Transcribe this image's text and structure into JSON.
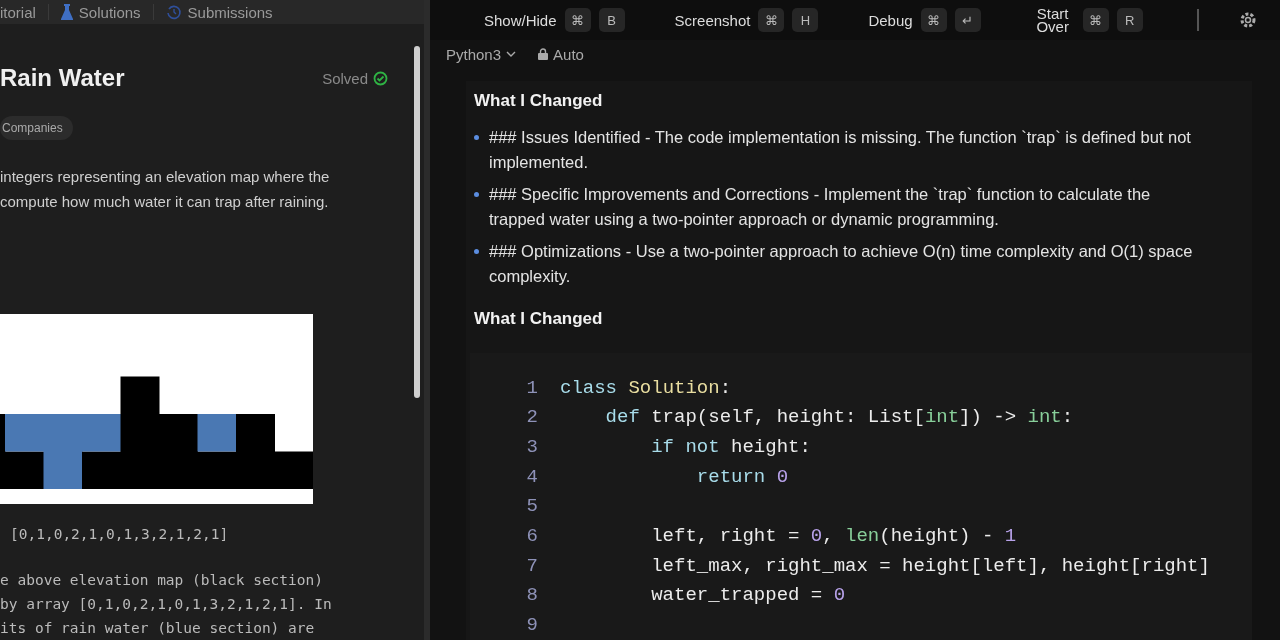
{
  "problem_tabs": [
    {
      "label": "itorial"
    },
    {
      "label": "Solutions"
    },
    {
      "label": "Submissions"
    }
  ],
  "problem": {
    "title": "Rain Water",
    "status": "Solved",
    "tag": "Companies",
    "description": [
      "integers representing an elevation map where the",
      "compute how much water it can trap after raining."
    ],
    "example_input": "[0,1,0,2,1,0,1,3,2,1,2,1]",
    "explanation": [
      "e above elevation map (black section)",
      "by array [0,1,0,2,1,0,1,3,2,1,2,1]. In",
      "its of rain water (blue section) are"
    ]
  },
  "toolbar": {
    "actions": [
      {
        "label": "Show/Hide",
        "keys": [
          "⌘",
          "B"
        ]
      },
      {
        "label": "Screenshot",
        "keys": [
          "⌘",
          "H"
        ]
      },
      {
        "label": "Debug",
        "keys": [
          "⌘",
          "↵"
        ]
      },
      {
        "label": "Start Over",
        "keys": [
          "⌘",
          "R"
        ]
      }
    ]
  },
  "editor": {
    "language": "Python3",
    "mode": "Auto"
  },
  "overlay": {
    "heading": "What I Changed",
    "issues": [
      "### Issues Identified - The code implementation is missing. The function `trap` is defined but not implemented.",
      "### Specific Improvements and Corrections - Implement the `trap` function to calculate the trapped water using a two-pointer approach or dynamic programming.",
      "### Optimizations - Use a two-pointer approach to achieve O(n) time complexity and O(1) space complexity."
    ],
    "section_title": "What I Changed",
    "code": [
      {
        "number": "1",
        "tokens": [
          {
            "text": "class ",
            "kind": "keyword"
          },
          {
            "text": "Solution",
            "kind": "class"
          },
          {
            "text": ":",
            "kind": "plain"
          }
        ]
      },
      {
        "number": "2",
        "tokens": [
          {
            "text": "    def ",
            "kind": "keyword"
          },
          {
            "text": "trap(self, height: List[",
            "kind": "plain"
          },
          {
            "text": "int",
            "kind": "builtin"
          },
          {
            "text": "]) -> ",
            "kind": "plain"
          },
          {
            "text": "int",
            "kind": "builtin"
          },
          {
            "text": ":",
            "kind": "plain"
          }
        ]
      },
      {
        "number": "3",
        "tokens": [
          {
            "text": "        if not ",
            "kind": "keyword"
          },
          {
            "text": "height:",
            "kind": "plain"
          }
        ]
      },
      {
        "number": "4",
        "tokens": [
          {
            "text": "            return ",
            "kind": "keyword"
          },
          {
            "text": "0",
            "kind": "number"
          }
        ]
      },
      {
        "number": "5"
      },
      {
        "number": "6",
        "tokens": [
          {
            "text": "        left, right = ",
            "kind": "plain"
          },
          {
            "text": "0",
            "kind": "number"
          },
          {
            "text": ", ",
            "kind": "plain"
          },
          {
            "text": "len",
            "kind": "builtin"
          },
          {
            "text": "(height) - ",
            "kind": "plain"
          },
          {
            "text": "1",
            "kind": "number"
          }
        ]
      },
      {
        "number": "7",
        "tokens": [
          {
            "text": "        left_max, right_max = height[left], height[right]",
            "kind": "plain"
          }
        ]
      },
      {
        "number": "8",
        "tokens": [
          {
            "text": "        water_trapped = ",
            "kind": "plain"
          },
          {
            "text": "0",
            "kind": "number"
          }
        ]
      },
      {
        "number": "9"
      }
    ]
  }
}
